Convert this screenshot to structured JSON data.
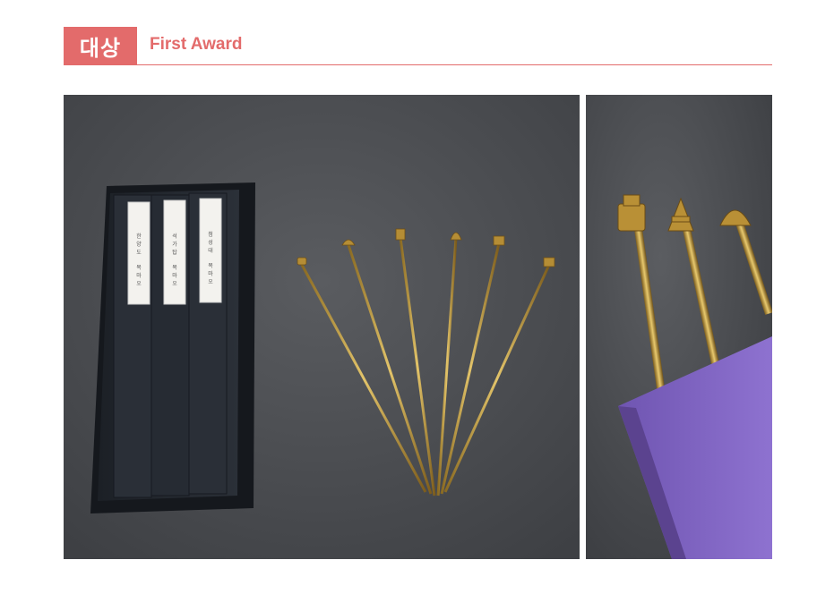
{
  "header": {
    "badge_label": "대상",
    "award_title": "First Award",
    "accent_color": "#e36b6b"
  },
  "photos": {
    "main": {
      "box_labels": [
        [
          "한",
          "양",
          "도",
          "목",
          "마",
          "오"
        ],
        [
          "석",
          "가",
          "탑",
          "목",
          "마",
          "오"
        ],
        [
          "첨",
          "성",
          "대",
          "목",
          "마",
          "오"
        ]
      ]
    },
    "side": {
      "book_color": "#8b6cc9"
    }
  }
}
